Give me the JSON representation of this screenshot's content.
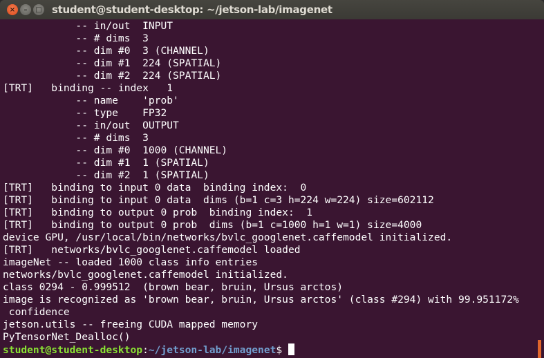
{
  "window": {
    "title": "student@student-desktop: ~/jetson-lab/imagenet",
    "buttons": {
      "close": "×",
      "minimize": "–",
      "maximize": "□"
    }
  },
  "terminal": {
    "lines": [
      "            -- in/out  INPUT",
      "            -- # dims  3",
      "            -- dim #0  3 (CHANNEL)",
      "            -- dim #1  224 (SPATIAL)",
      "            -- dim #2  224 (SPATIAL)",
      "[TRT]   binding -- index   1",
      "            -- name    'prob'",
      "            -- type    FP32",
      "            -- in/out  OUTPUT",
      "            -- # dims  3",
      "            -- dim #0  1000 (CHANNEL)",
      "            -- dim #1  1 (SPATIAL)",
      "            -- dim #2  1 (SPATIAL)",
      "[TRT]   binding to input 0 data  binding index:  0",
      "[TRT]   binding to input 0 data  dims (b=1 c=3 h=224 w=224) size=602112",
      "[TRT]   binding to output 0 prob  binding index:  1",
      "[TRT]   binding to output 0 prob  dims (b=1 c=1000 h=1 w=1) size=4000",
      "device GPU, /usr/local/bin/networks/bvlc_googlenet.caffemodel initialized.",
      "[TRT]   networks/bvlc_googlenet.caffemodel loaded",
      "imageNet -- loaded 1000 class info entries",
      "networks/bvlc_googlenet.caffemodel initialized.",
      "class 0294 - 0.999512  (brown bear, bruin, Ursus arctos)",
      "image is recognized as 'brown bear, bruin, Ursus arctos' (class #294) with 99.951172%",
      " confidence",
      "jetson.utils -- freeing CUDA mapped memory",
      "PyTensorNet_Dealloc()"
    ],
    "prompt": {
      "user_host": "student@student-desktop",
      "separator": ":",
      "path": "~/jetson-lab/imagenet",
      "symbol": "$"
    },
    "colors": {
      "background": "#3a1531",
      "prompt_user": "#8ae234",
      "prompt_path": "#729fcf",
      "scrollbar": "#e0662c"
    }
  }
}
